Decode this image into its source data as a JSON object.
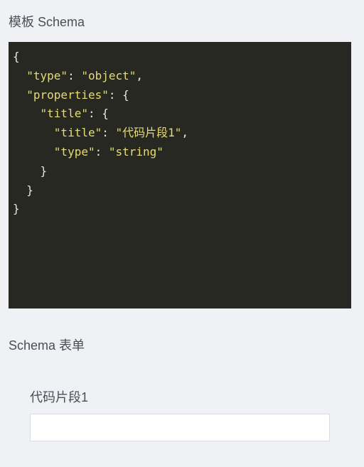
{
  "template_section": {
    "title": "模板 Schema"
  },
  "code_editor": {
    "lines": [
      [
        {
          "t": "punc",
          "v": "{"
        }
      ],
      [
        {
          "t": "punc",
          "v": "  "
        },
        {
          "t": "key",
          "v": "\"type\""
        },
        {
          "t": "punc",
          "v": ": "
        },
        {
          "t": "str",
          "v": "\"object\""
        },
        {
          "t": "punc",
          "v": ","
        }
      ],
      [
        {
          "t": "punc",
          "v": "  "
        },
        {
          "t": "key",
          "v": "\"properties\""
        },
        {
          "t": "punc",
          "v": ": {"
        }
      ],
      [
        {
          "t": "punc",
          "v": "    "
        },
        {
          "t": "key",
          "v": "\"title\""
        },
        {
          "t": "punc",
          "v": ": {"
        }
      ],
      [
        {
          "t": "punc",
          "v": "      "
        },
        {
          "t": "key",
          "v": "\"title\""
        },
        {
          "t": "punc",
          "v": ": "
        },
        {
          "t": "str",
          "v": "\"代码片段1\""
        },
        {
          "t": "punc",
          "v": ","
        }
      ],
      [
        {
          "t": "punc",
          "v": "      "
        },
        {
          "t": "key",
          "v": "\"type\""
        },
        {
          "t": "punc",
          "v": ": "
        },
        {
          "t": "str",
          "v": "\"string\""
        }
      ],
      [
        {
          "t": "punc",
          "v": "    }"
        }
      ],
      [
        {
          "t": "punc",
          "v": "  }"
        }
      ],
      [
        {
          "t": "punc",
          "v": "}"
        }
      ]
    ]
  },
  "form_section": {
    "title": "Schema 表单",
    "field": {
      "label": "代码片段1",
      "value": "",
      "placeholder": ""
    }
  },
  "colors": {
    "page_background": "#f0f1f5",
    "code_background": "#272822",
    "code_string": "#e6db74",
    "code_text": "#e6e6dc"
  }
}
